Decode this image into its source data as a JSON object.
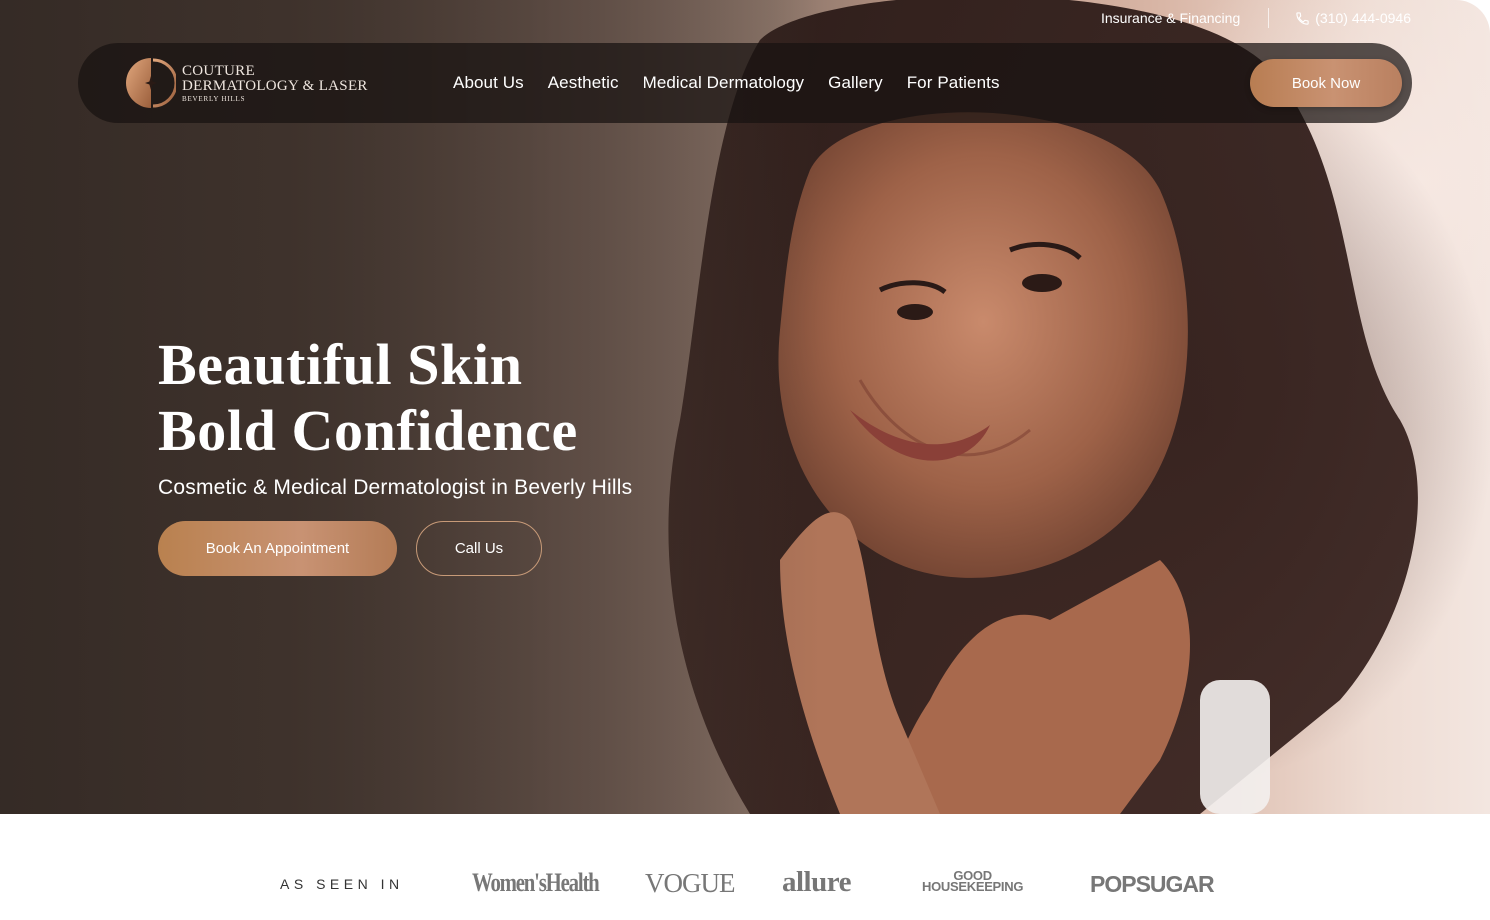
{
  "utility_bar": {
    "insurance_link": "Insurance & Financing",
    "phone": "(310) 444-0946",
    "phone_icon": "phone-icon"
  },
  "brand": {
    "line1": "COUTURE",
    "line2": "DERMATOLOGY & LASER",
    "line3": "BEVERLY HILLS"
  },
  "nav": {
    "items": [
      {
        "label": "About Us"
      },
      {
        "label": "Aesthetic"
      },
      {
        "label": "Medical Dermatology"
      },
      {
        "label": "Gallery"
      },
      {
        "label": "For Patients"
      }
    ],
    "cta_label": "Book Now"
  },
  "hero": {
    "headline_line1": "Beautiful Skin",
    "headline_line2": "Bold Confidence",
    "subheadline": "Cosmetic & Medical Dermatologist in Beverly Hills",
    "primary_button": "Book An Appointment",
    "secondary_button": "Call Us"
  },
  "press": {
    "label": "AS SEEN IN",
    "logos": [
      {
        "name": "WomensHealth",
        "text": "Women'sHealth"
      },
      {
        "name": "Vogue",
        "text": "VOGUE"
      },
      {
        "name": "Allure",
        "text": "allure"
      },
      {
        "name": "Good Housekeeping",
        "text_line1": "GOOD",
        "text_line2": "HOUSEKEEPING"
      },
      {
        "name": "Popsugar",
        "text": "POPSUGAR"
      }
    ]
  },
  "colors": {
    "accent_copper": "#c28a63",
    "nav_background": "#181210",
    "hero_dark": "#3f332d",
    "press_logo_gray": "#777777"
  }
}
